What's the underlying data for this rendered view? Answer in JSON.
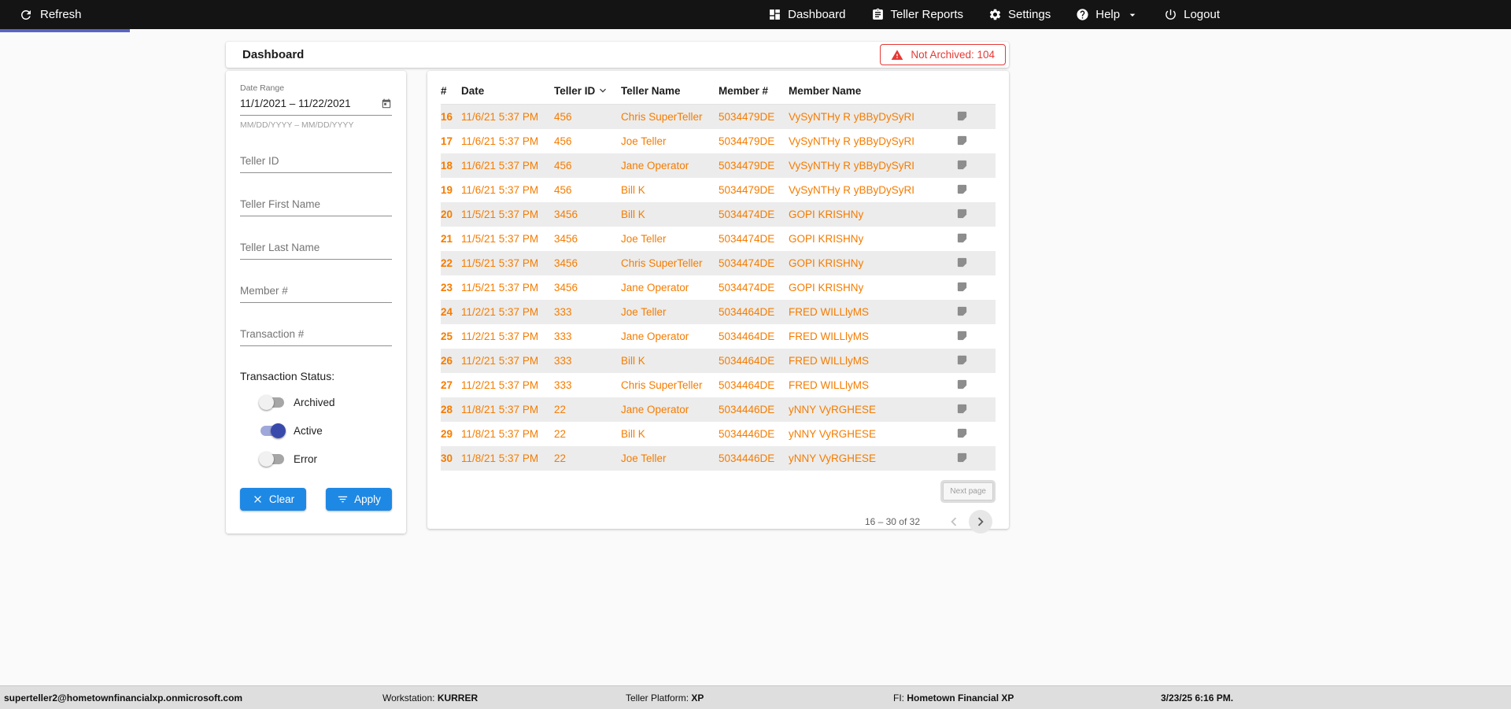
{
  "topbar": {
    "refresh_label": "Refresh",
    "nav": [
      {
        "label": "Dashboard"
      },
      {
        "label": "Teller Reports"
      },
      {
        "label": "Settings"
      },
      {
        "label": "Help"
      },
      {
        "label": "Logout"
      }
    ]
  },
  "header": {
    "title": "Dashboard",
    "not_archived_badge": "Not Archived: 104"
  },
  "filters": {
    "date_range_label": "Date Range",
    "date_range_value": "11/1/2021 – 11/22/2021",
    "date_range_hint": "MM/DD/YYYY – MM/DD/YYYY",
    "teller_id_placeholder": "Teller ID",
    "teller_first_name_placeholder": "Teller First Name",
    "teller_last_name_placeholder": "Teller Last Name",
    "member_placeholder": "Member #",
    "transaction_placeholder": "Transaction #",
    "status_label": "Transaction Status:",
    "toggles": [
      {
        "label": "Archived",
        "on": false
      },
      {
        "label": "Active",
        "on": true
      },
      {
        "label": "Error",
        "on": false
      }
    ],
    "clear_label": "Clear",
    "apply_label": "Apply"
  },
  "table": {
    "columns": [
      "#",
      "Date",
      "Teller ID",
      "Teller Name",
      "Member #",
      "Member Name"
    ],
    "sort": {
      "column": "Teller ID",
      "direction": "desc"
    },
    "rows": [
      {
        "num": "16",
        "date": "11/6/21 5:37 PM",
        "teller_id": "456",
        "teller_name": "Chris SuperTeller",
        "member_num": "5034479DE",
        "member_name": "VySyNTHy R yBByDySyRI"
      },
      {
        "num": "17",
        "date": "11/6/21 5:37 PM",
        "teller_id": "456",
        "teller_name": "Joe Teller",
        "member_num": "5034479DE",
        "member_name": "VySyNTHy R yBByDySyRI"
      },
      {
        "num": "18",
        "date": "11/6/21 5:37 PM",
        "teller_id": "456",
        "teller_name": "Jane Operator",
        "member_num": "5034479DE",
        "member_name": "VySyNTHy R yBByDySyRI"
      },
      {
        "num": "19",
        "date": "11/6/21 5:37 PM",
        "teller_id": "456",
        "teller_name": "Bill K",
        "member_num": "5034479DE",
        "member_name": "VySyNTHy R yBByDySyRI"
      },
      {
        "num": "20",
        "date": "11/5/21 5:37 PM",
        "teller_id": "3456",
        "teller_name": "Bill K",
        "member_num": "5034474DE",
        "member_name": "GOPI KRISHNy"
      },
      {
        "num": "21",
        "date": "11/5/21 5:37 PM",
        "teller_id": "3456",
        "teller_name": "Joe Teller",
        "member_num": "5034474DE",
        "member_name": "GOPI KRISHNy"
      },
      {
        "num": "22",
        "date": "11/5/21 5:37 PM",
        "teller_id": "3456",
        "teller_name": "Chris SuperTeller",
        "member_num": "5034474DE",
        "member_name": "GOPI KRISHNy"
      },
      {
        "num": "23",
        "date": "11/5/21 5:37 PM",
        "teller_id": "3456",
        "teller_name": "Jane Operator",
        "member_num": "5034474DE",
        "member_name": "GOPI KRISHNy"
      },
      {
        "num": "24",
        "date": "11/2/21 5:37 PM",
        "teller_id": "333",
        "teller_name": "Joe Teller",
        "member_num": "5034464DE",
        "member_name": "FRED WILLlyMS"
      },
      {
        "num": "25",
        "date": "11/2/21 5:37 PM",
        "teller_id": "333",
        "teller_name": "Jane Operator",
        "member_num": "5034464DE",
        "member_name": "FRED WILLlyMS"
      },
      {
        "num": "26",
        "date": "11/2/21 5:37 PM",
        "teller_id": "333",
        "teller_name": "Bill K",
        "member_num": "5034464DE",
        "member_name": "FRED WILLlyMS"
      },
      {
        "num": "27",
        "date": "11/2/21 5:37 PM",
        "teller_id": "333",
        "teller_name": "Chris SuperTeller",
        "member_num": "5034464DE",
        "member_name": "FRED WILLlyMS"
      },
      {
        "num": "28",
        "date": "11/8/21 5:37 PM",
        "teller_id": "22",
        "teller_name": "Jane Operator",
        "member_num": "5034446DE",
        "member_name": "yNNY VyRGHESE"
      },
      {
        "num": "29",
        "date": "11/8/21 5:37 PM",
        "teller_id": "22",
        "teller_name": "Bill K",
        "member_num": "5034446DE",
        "member_name": "yNNY VyRGHESE"
      },
      {
        "num": "30",
        "date": "11/8/21 5:37 PM",
        "teller_id": "22",
        "teller_name": "Joe Teller",
        "member_num": "5034446DE",
        "member_name": "yNNY VyRGHESE"
      }
    ]
  },
  "pagination": {
    "next_page_label": "Next page",
    "range_text": "16 – 30 of 32"
  },
  "statusbar": {
    "user": "superteller2@hometownfinancialxp.onmicrosoft.com",
    "workstation_label": "Workstation:",
    "workstation_value": "KURRER",
    "platform_label": "Teller Platform:",
    "platform_value": "XP",
    "fi_label": "FI:",
    "fi_value": "Hometown Financial XP",
    "datetime": "3/23/25 6:16 PM."
  },
  "colors": {
    "accent_blue": "#1e88e5",
    "row_orange": "#f57c00",
    "badge_red": "#e53935",
    "active_indicator": "#5a64c4",
    "topbar_bg": "#141414"
  }
}
